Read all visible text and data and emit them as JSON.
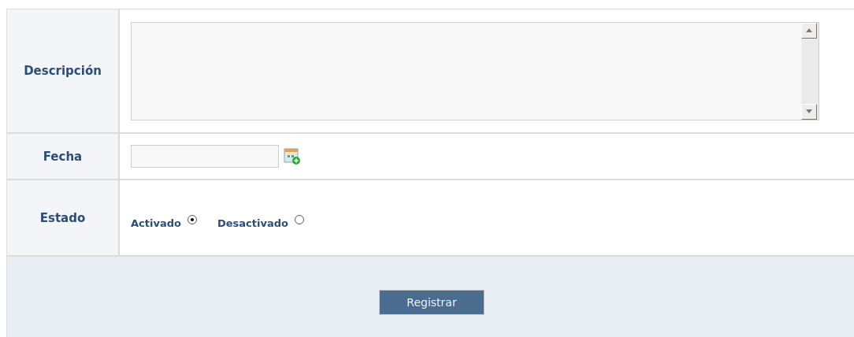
{
  "form": {
    "rows": [
      {
        "kind": "textarea",
        "label": "Descripción"
      },
      {
        "kind": "date",
        "label": "Fecha"
      },
      {
        "kind": "radio",
        "label": "Estado",
        "options": [
          {
            "label": "Activado",
            "selected": true
          },
          {
            "label": "Desactivado",
            "selected": false
          }
        ]
      }
    ]
  },
  "submit_button": "Registrar"
}
